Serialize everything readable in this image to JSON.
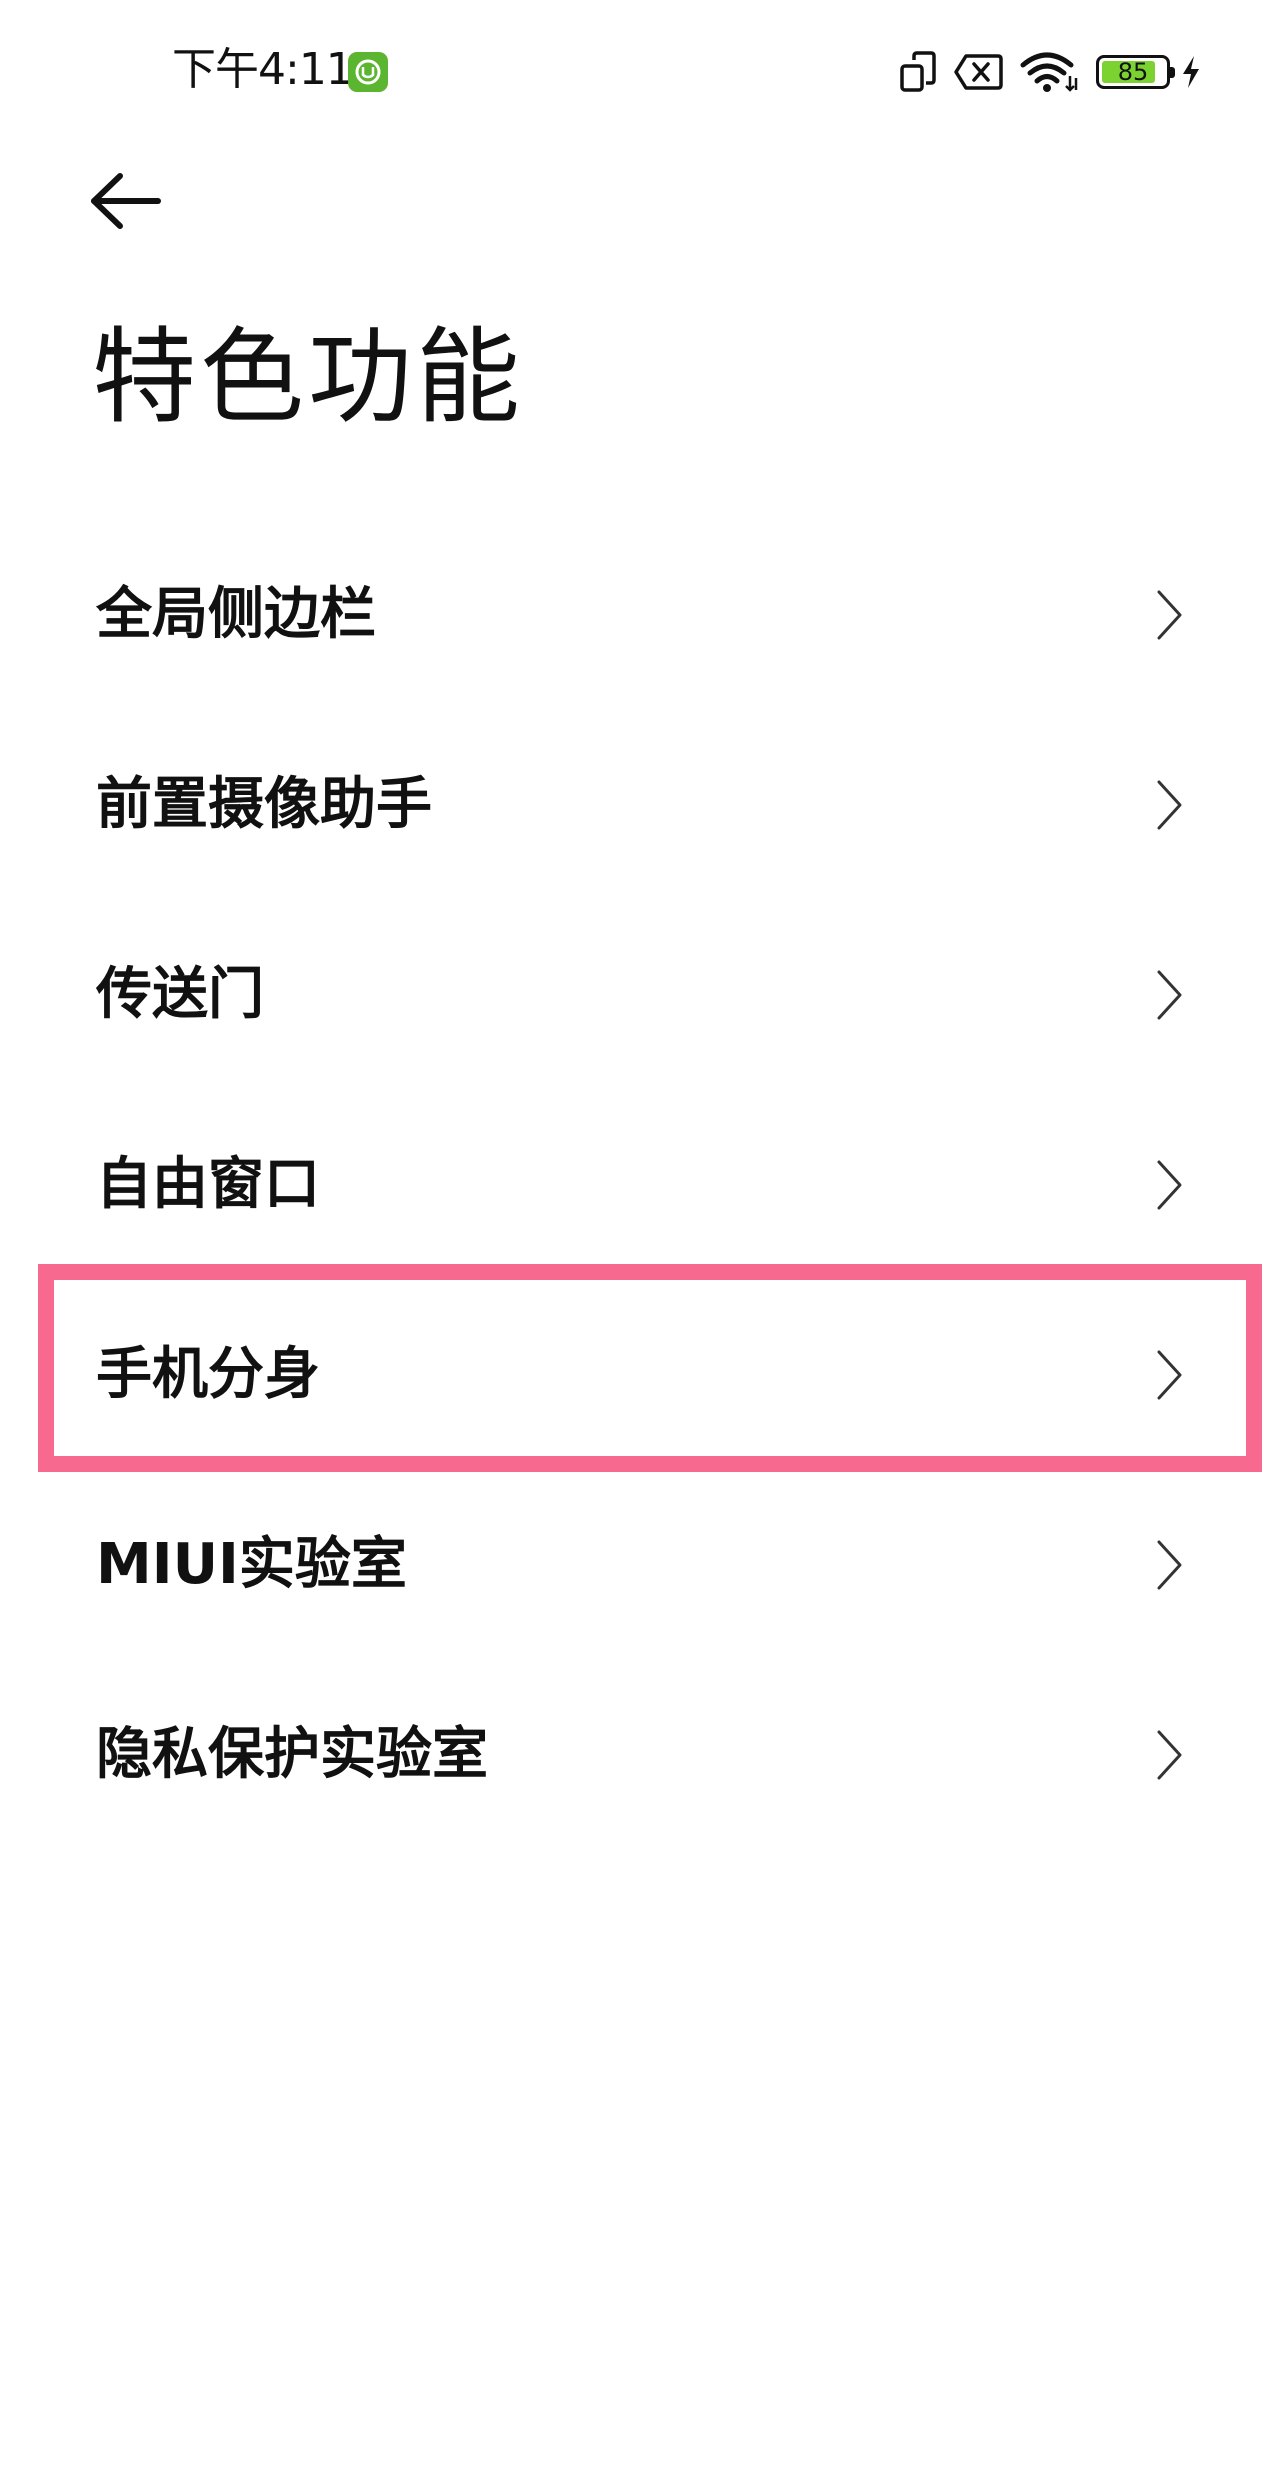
{
  "status_bar": {
    "time": "下午4:11",
    "battery_level": "85",
    "battery_fraction": 0.85,
    "icons": [
      "notification-badge-icon",
      "screen-rotate-icon",
      "no-sim-icon",
      "wifi-icon",
      "battery-icon",
      "charging-icon"
    ]
  },
  "header": {
    "back_icon": "back-arrow-icon",
    "title": "特色功能"
  },
  "list": {
    "items": [
      {
        "label": "全局侧边栏"
      },
      {
        "label": "前置摄像助手"
      },
      {
        "label": "传送门"
      },
      {
        "label": "自由窗口"
      },
      {
        "label": "手机分身"
      },
      {
        "label": "MIUI实验室"
      },
      {
        "label": "隐私保护实验室"
      }
    ],
    "chevron_icon": "chevron-right-icon"
  },
  "colors": {
    "background": "#ffffff",
    "text": "#111111",
    "highlight": "#f7698f",
    "battery_fill": "#7bd332",
    "notification_badge": "#5cb531"
  }
}
